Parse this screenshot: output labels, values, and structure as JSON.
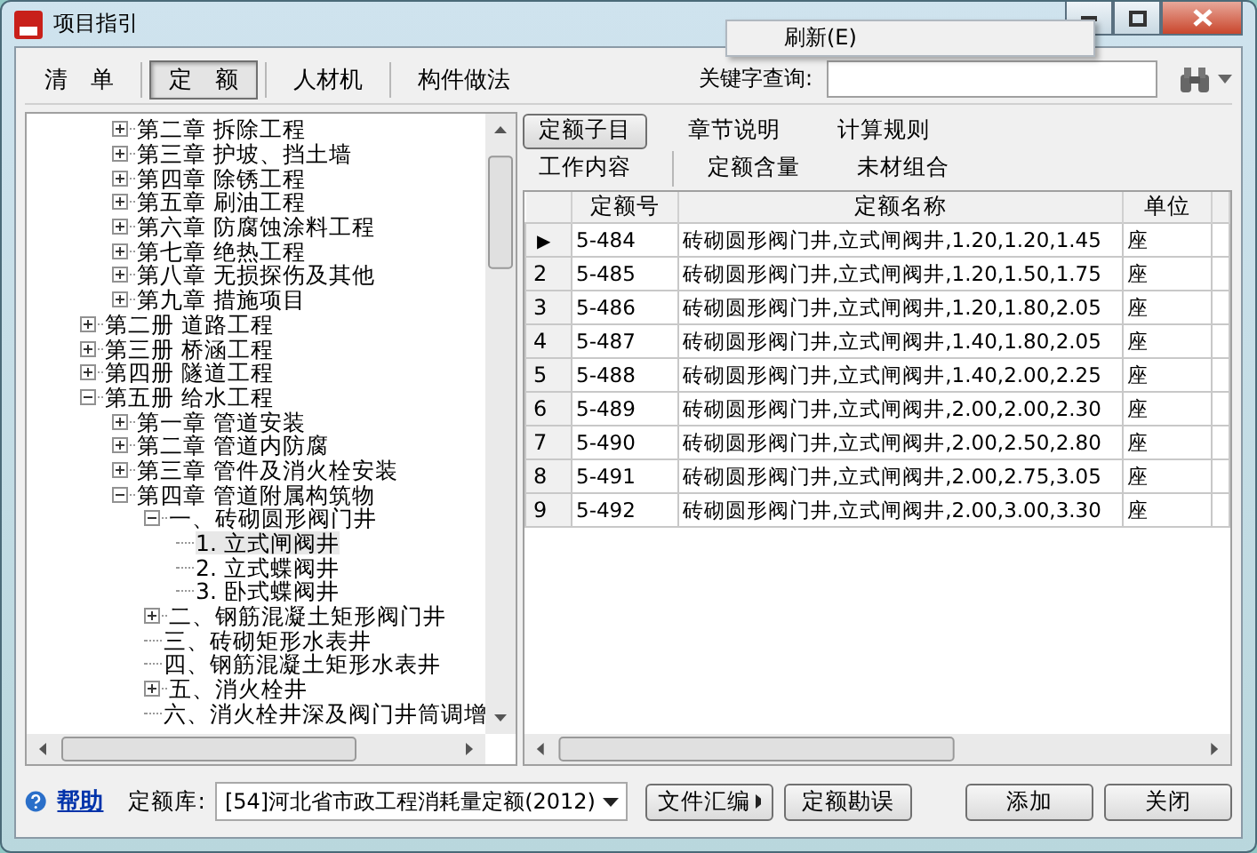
{
  "window": {
    "title": "项目指引"
  },
  "popup_menu": {
    "items": [
      "刷新(E)"
    ]
  },
  "toolbar": {
    "tabs": [
      {
        "label": "清　单",
        "selected": false
      },
      {
        "label": "定　额",
        "selected": true
      },
      {
        "label": "人材机",
        "selected": false
      },
      {
        "label": "构件做法",
        "selected": false
      }
    ],
    "search": {
      "label": "关键字查询:"
    }
  },
  "tree": {
    "items": [
      {
        "kind": "hidden",
        "children": [
          {
            "kind": "node",
            "label": "第二章  拆除工程",
            "expanded": false,
            "selected": false
          },
          {
            "kind": "node",
            "label": "第三章  护坡、挡土墙",
            "expanded": false,
            "selected": false
          },
          {
            "kind": "node",
            "label": "第四章  除锈工程",
            "expanded": false,
            "selected": false
          },
          {
            "kind": "node",
            "label": "第五章  刷油工程",
            "expanded": false,
            "selected": false
          },
          {
            "kind": "node",
            "label": "第六章  防腐蚀涂料工程",
            "expanded": false,
            "selected": false
          },
          {
            "kind": "node",
            "label": "第七章  绝热工程",
            "expanded": false,
            "selected": false
          },
          {
            "kind": "node",
            "label": "第八章  无损探伤及其他",
            "expanded": false,
            "selected": false
          },
          {
            "kind": "node",
            "label": "第九章  措施项目",
            "expanded": false,
            "selected": false
          }
        ]
      },
      {
        "kind": "node",
        "label": "第二册  道路工程",
        "expanded": false,
        "selected": false
      },
      {
        "kind": "node",
        "label": "第三册  桥涵工程",
        "expanded": false,
        "selected": false
      },
      {
        "kind": "node",
        "label": "第四册  隧道工程",
        "expanded": false,
        "selected": false
      },
      {
        "kind": "node",
        "label": "第五册  给水工程",
        "expanded": true,
        "selected": false,
        "children": [
          {
            "kind": "node",
            "label": "第一章  管道安装",
            "expanded": false,
            "selected": false
          },
          {
            "kind": "node",
            "label": "第二章  管道内防腐",
            "expanded": false,
            "selected": false
          },
          {
            "kind": "node",
            "label": "第三章  管件及消火栓安装",
            "expanded": false,
            "selected": false
          },
          {
            "kind": "node",
            "label": "第四章  管道附属构筑物",
            "expanded": true,
            "selected": false,
            "children": [
              {
                "kind": "node",
                "label": "一、砖砌圆形阀门井",
                "expanded": true,
                "selected": false,
                "children": [
                  {
                    "kind": "leaf",
                    "label": "1. 立式闸阀井",
                    "selected": true
                  },
                  {
                    "kind": "leaf",
                    "label": "2. 立式蝶阀井",
                    "selected": false
                  },
                  {
                    "kind": "leaf",
                    "label": "3. 卧式蝶阀井",
                    "selected": false
                  }
                ]
              },
              {
                "kind": "node",
                "label": "二、钢筋混凝土矩形阀门井",
                "expanded": false,
                "selected": false
              },
              {
                "kind": "leaf",
                "label": "三、砖砌矩形水表井",
                "selected": false
              },
              {
                "kind": "leaf",
                "label": "四、钢筋混凝土矩形水表井",
                "selected": false
              },
              {
                "kind": "node",
                "label": "五、消火栓井",
                "expanded": false,
                "selected": false
              },
              {
                "kind": "leaf",
                "label": "六、消火栓井深及阀门井筒调增",
                "selected": false
              }
            ]
          }
        ]
      }
    ]
  },
  "detail_tabs": [
    [
      {
        "label": "定额子目",
        "selected": true
      },
      {
        "label": "章节说明",
        "selected": false
      },
      {
        "label": "计算规则",
        "selected": false
      }
    ],
    [
      {
        "label": "工作内容",
        "selected": false
      },
      {
        "label": "定额含量",
        "selected": false
      },
      {
        "label": "未材组合",
        "selected": false
      }
    ]
  ],
  "table": {
    "columns": [
      "定额号",
      "定额名称",
      "单位"
    ],
    "rows": [
      {
        "marker": "▶",
        "code": "5-484",
        "name": "砖砌圆形阀门井,立式闸阀井,1.20,1.20,1.45",
        "unit": "座",
        "current": true
      },
      {
        "marker": "2",
        "code": "5-485",
        "name": "砖砌圆形阀门井,立式闸阀井,1.20,1.50,1.75",
        "unit": "座",
        "current": false
      },
      {
        "marker": "3",
        "code": "5-486",
        "name": "砖砌圆形阀门井,立式闸阀井,1.20,1.80,2.05",
        "unit": "座",
        "current": false
      },
      {
        "marker": "4",
        "code": "5-487",
        "name": "砖砌圆形阀门井,立式闸阀井,1.40,1.80,2.05",
        "unit": "座",
        "current": false
      },
      {
        "marker": "5",
        "code": "5-488",
        "name": "砖砌圆形阀门井,立式闸阀井,1.40,2.00,2.25",
        "unit": "座",
        "current": false
      },
      {
        "marker": "6",
        "code": "5-489",
        "name": "砖砌圆形阀门井,立式闸阀井,2.00,2.00,2.30",
        "unit": "座",
        "current": false
      },
      {
        "marker": "7",
        "code": "5-490",
        "name": "砖砌圆形阀门井,立式闸阀井,2.00,2.50,2.80",
        "unit": "座",
        "current": false
      },
      {
        "marker": "8",
        "code": "5-491",
        "name": "砖砌圆形阀门井,立式闸阀井,2.00,2.75,3.05",
        "unit": "座",
        "current": false
      },
      {
        "marker": "9",
        "code": "5-492",
        "name": "砖砌圆形阀门井,立式闸阀井,2.00,3.00,3.30",
        "unit": "座",
        "current": false
      }
    ]
  },
  "footer": {
    "help": "帮助",
    "library_label": "定额库:",
    "library": "[54]河北省市政工程消耗量定额(2012)",
    "buttons": [
      {
        "label": "文件汇编",
        "kind": "menu"
      },
      {
        "label": "定额勘误",
        "kind": "plain"
      },
      {
        "label": "添加",
        "kind": "plain"
      },
      {
        "label": "关闭",
        "kind": "plain"
      }
    ]
  }
}
